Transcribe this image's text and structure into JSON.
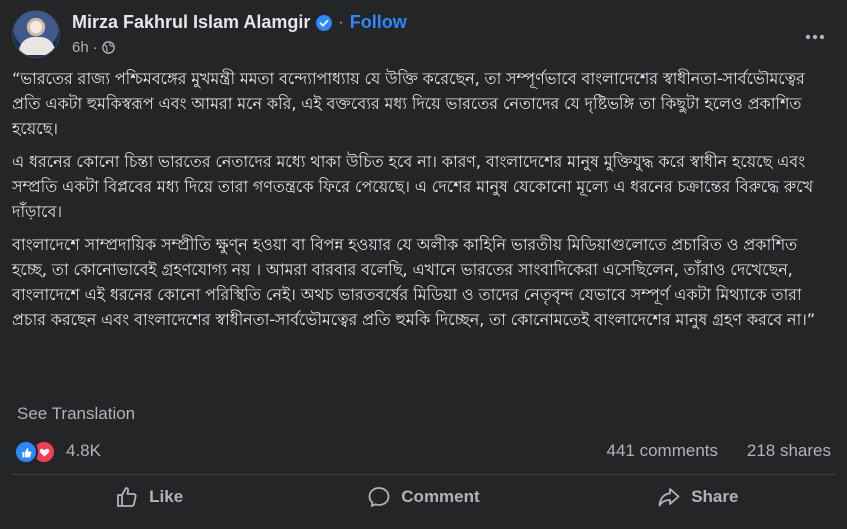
{
  "header": {
    "author_name": "Mirza Fakhrul Islam Alamgir",
    "separator": "·",
    "follow_label": "Follow",
    "timestamp": "6h",
    "meta_separator": "·",
    "icons": {
      "verified": "verified-badge-icon",
      "audience": "globe-icon",
      "more": "more-horizontal-icon"
    }
  },
  "post": {
    "paragraphs": [
      "“ভারতের রাজ্য পশ্চিমবঙ্গের মুখমন্ত্রী মমতা বন্দ্যোপাধ্যায় যে উক্তি করেছেন, তা সম্পূর্ণভাবে বাংলাদেশের স্বাধীনতা-সার্বভৌমত্বের প্রতি একটা হুমকিস্বরূপ এবং আমরা মনে করি, এই বক্তব্যের মধ্য দিয়ে ভারতের নেতাদের যে দৃষ্টিভঙ্গি তা কিছুটা হলেও প্রকাশিত হয়েছে।",
      "এ ধরনের কোনো চিন্তা ভারতের নেতাদের মধ্যে থাকা উচিত হবে না। কারণ, বাংলাদেশের মানুষ মুক্তিযুদ্ধ করে স্বাধীন হয়েছে এবং সম্প্রতি একটা বিপ্লবের মধ্য দিয়ে তারা গণতন্ত্রকে ফিরে পেয়েছে। এ দেশের মানুষ যেকোনো মূল্যে এ ধরনের চক্রান্তের বিরুদ্ধে রুখে দাঁড়াবে।",
      "বাংলাদেশে সাম্প্রদায়িক সম্প্রীতি ক্ষুণ্ন হওয়া বা বিপন্ন হওয়ার যে অলীক কাহিনি ভারতীয় মিডিয়াগুলোতে প্রচারিত ও প্রকাশিত হচ্ছে, তা কোনোভাবেই গ্রহণযোগ্য নয় । আমরা বারবার বলেছি, এখানে ভারতের সাংবাদিকেরা এসেছিলেন, তাঁরাও দেখেছেন, বাংলাদেশে এই ধরনের কোনো পরিস্থিতি নেই। অথচ ভারতবর্ষের মিডিয়া ও তাদের নেতৃবৃন্দ যেভাবে সম্পূর্ণ একটা মিথ্যাকে তারা প্রচার করছেন এবং বাংলাদেশের স্বাধীনতা-সার্বভৌমত্বের প্রতি হুমকি দিচ্ছেন, তা কোনোমতেই বাংলাদেশের মানুষ গ্রহণ করবে না।”"
    ],
    "see_translation_label": "See Translation"
  },
  "engagement": {
    "reaction_count": "4.8K",
    "comments_label": "441 comments",
    "shares_label": "218 shares",
    "reaction_types": [
      "like-reaction-icon",
      "love-reaction-icon"
    ]
  },
  "actions": {
    "like_label": "Like",
    "comment_label": "Comment",
    "share_label": "Share"
  },
  "colors": {
    "background": "#242526",
    "text_primary": "#E4E6EB",
    "text_secondary": "#B0B3B8",
    "accent_blue": "#2D88FF",
    "love_red": "#F33E58",
    "divider": "#3E4042"
  }
}
